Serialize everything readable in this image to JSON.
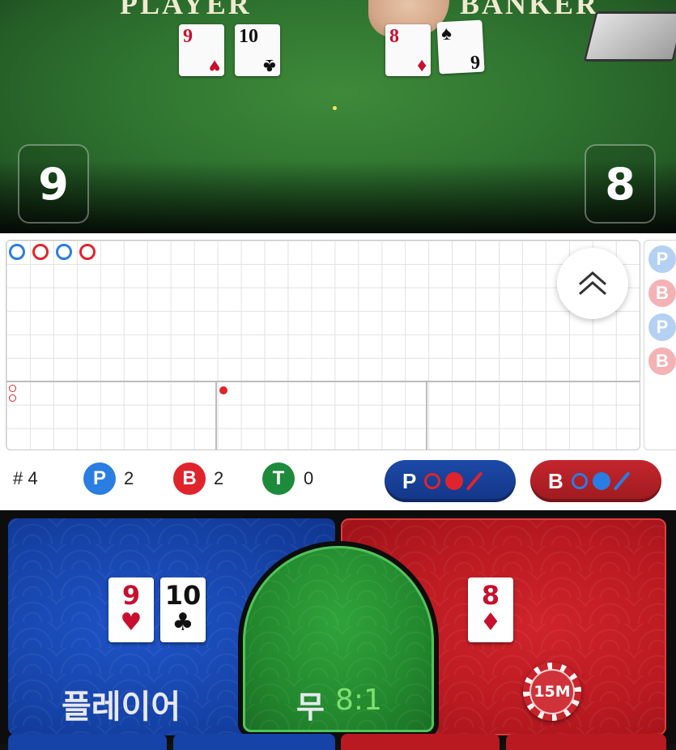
{
  "video": {
    "player_label": "PLAYER",
    "banker_label": "BANKER",
    "player_score": "9",
    "banker_score": "8",
    "player_cards": [
      {
        "rank": "9",
        "suit": "♥",
        "color": "red"
      },
      {
        "rank": "10",
        "suit": "♣",
        "color": "black"
      }
    ],
    "banker_cards": [
      {
        "rank": "8",
        "suit": "♦",
        "color": "red"
      },
      {
        "rank": "6",
        "suit": "♠",
        "color": "black"
      }
    ]
  },
  "roadmap": {
    "bead_road": [
      "P",
      "B",
      "P",
      "B"
    ],
    "side_chips": [
      "P",
      "B",
      "P",
      "B"
    ],
    "stats": {
      "count_label": "# 4",
      "player_letter": "P",
      "player_count": "2",
      "banker_letter": "B",
      "banker_count": "2",
      "tie_letter": "T",
      "tie_count": "0"
    },
    "predict_player_label": "P",
    "predict_banker_label": "B"
  },
  "betting": {
    "player_label": "플레이어",
    "tie_label": "무",
    "tie_odds": "8:1",
    "player_cards": [
      {
        "rank": "9",
        "suit": "♥",
        "color": "red"
      },
      {
        "rank": "10",
        "suit": "♣",
        "color": "black"
      }
    ],
    "banker_cards": [
      {
        "rank": "8",
        "suit": "♦",
        "color": "red"
      }
    ],
    "chip_value": "15M"
  },
  "colors": {
    "player_blue": "#1543a8",
    "banker_red": "#b91920",
    "tie_green": "#238a2e",
    "bead_player": "#2a7de1",
    "bead_banker": "#e0242c"
  }
}
